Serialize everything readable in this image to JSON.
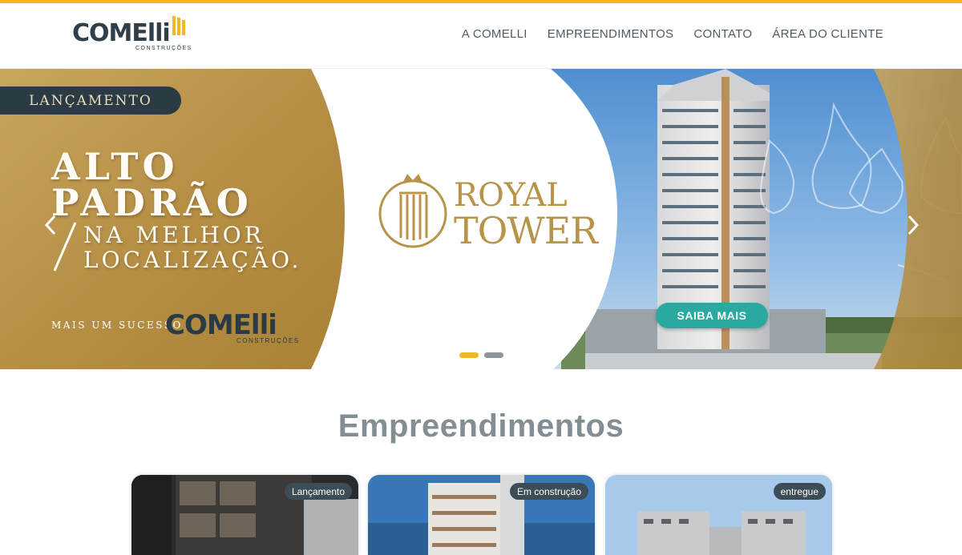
{
  "header": {
    "logo": {
      "word": "COMElli",
      "sub": "CONSTRUÇÕES"
    },
    "nav": [
      "A COMELLI",
      "EMPREENDIMENTOS",
      "CONTATO",
      "ÁREA DO CLIENTE"
    ]
  },
  "hero": {
    "badge": "LANÇAMENTO",
    "headline_line1": "ALTO",
    "headline_line2": "PADRÃO",
    "subline_line1": "NA MELHOR",
    "subline_line2": "LOCALIZAÇÃO.",
    "mais_text": "MAIS UM SUCESSO",
    "brand_word": "COMElli",
    "brand_sub": "CONSTRUÇÕES",
    "royal_line1": "ROYAL",
    "royal_line2": "TOWER",
    "cta": "SAIBA MAIS",
    "slides_total": 2,
    "slide_active": 1
  },
  "section": {
    "title": "Empreendimentos"
  },
  "cards": [
    {
      "tag": "Lançamento"
    },
    {
      "tag": "Em construção"
    },
    {
      "tag": "entregue"
    }
  ],
  "colors": {
    "accent": "#f2b824",
    "brand_dark": "#2f3e48",
    "gold": "#b79449",
    "teal": "#29a9a0",
    "nav_text": "#4f5a63",
    "title_gray": "#828d94"
  },
  "icons": {
    "prev": "chevron-left-icon",
    "next": "chevron-right-icon",
    "emblem": "crown-emblem-icon"
  }
}
